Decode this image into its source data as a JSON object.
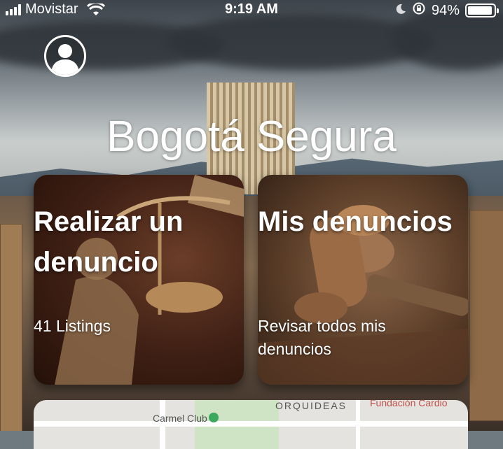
{
  "status_bar": {
    "carrier": "Movistar",
    "time": "9:19 AM",
    "battery": "94%",
    "battery_level": 0.94
  },
  "header": {
    "title": "Bogotá Segura"
  },
  "cards": [
    {
      "heading": "Realizar un denuncio",
      "subtitle": "41 Listings"
    },
    {
      "heading": "Mis denuncios",
      "subtitle": "Revisar todos mis denuncios"
    }
  ],
  "map": {
    "labels": [
      "Carmel Club",
      "ORQUIDEAS",
      "Fundación Cardio"
    ]
  }
}
